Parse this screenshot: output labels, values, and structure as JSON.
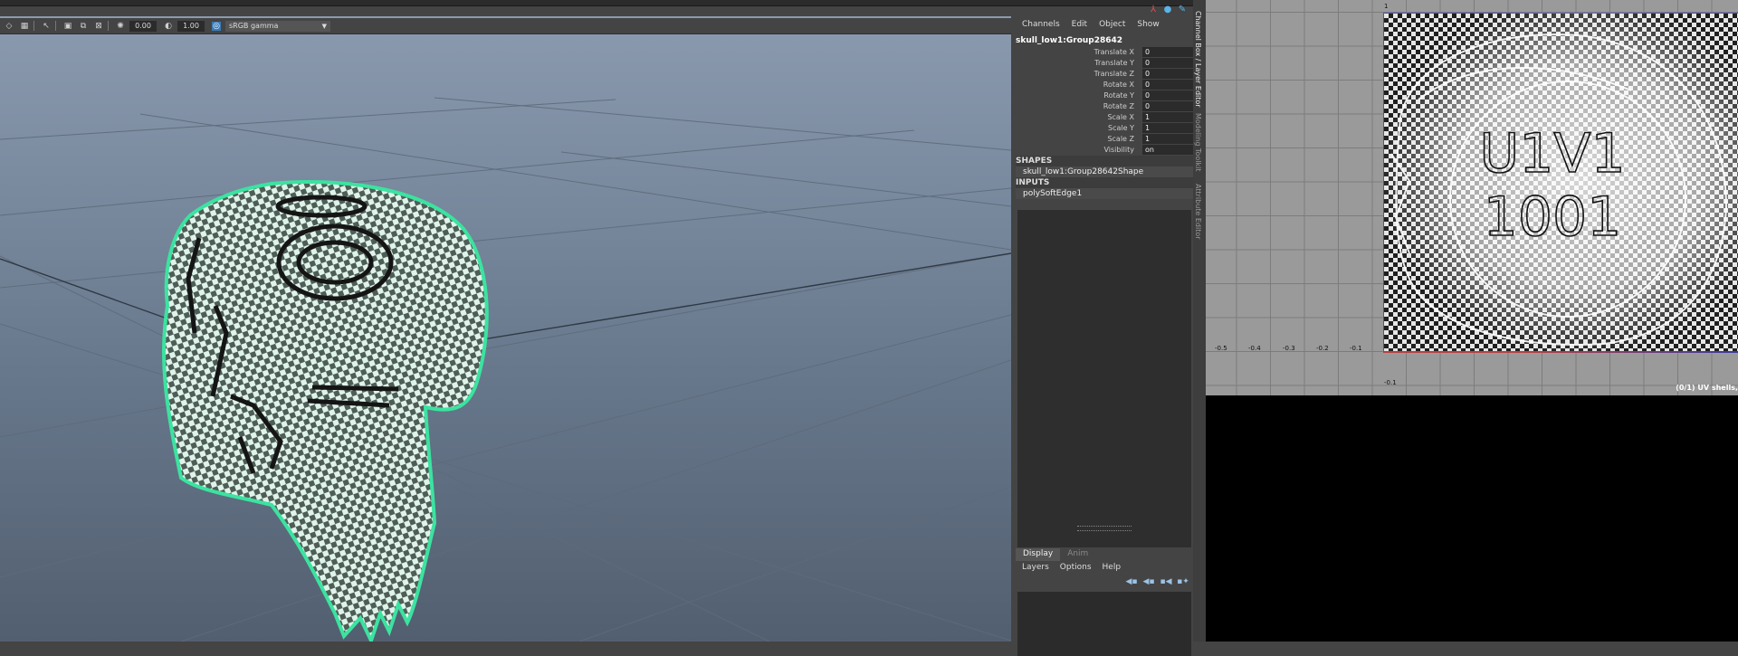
{
  "toolbar": {
    "exposure_value": "0.00",
    "gamma_value": "1.00",
    "color_space": "sRGB gamma"
  },
  "channel_box": {
    "menu": [
      "Channels",
      "Edit",
      "Object",
      "Show"
    ],
    "object_name": "skull_low1:Group28642",
    "attributes": [
      {
        "label": "Translate X",
        "value": "0"
      },
      {
        "label": "Translate Y",
        "value": "0"
      },
      {
        "label": "Translate Z",
        "value": "0"
      },
      {
        "label": "Rotate X",
        "value": "0"
      },
      {
        "label": "Rotate Y",
        "value": "0"
      },
      {
        "label": "Rotate Z",
        "value": "0"
      },
      {
        "label": "Scale X",
        "value": "1"
      },
      {
        "label": "Scale Y",
        "value": "1"
      },
      {
        "label": "Scale Z",
        "value": "1"
      },
      {
        "label": "Visibility",
        "value": "on"
      }
    ],
    "shapes_title": "SHAPES",
    "shape_item": "skull_low1:Group28642Shape",
    "inputs_title": "INPUTS",
    "input_item": "polySoftEdge1"
  },
  "layer_editor": {
    "tabs": [
      "Display",
      "Anim"
    ],
    "active_tab": "Display",
    "menu": [
      "Layers",
      "Options",
      "Help"
    ]
  },
  "side_tabs": [
    "Channel Box / Layer Editor",
    "Modeling Toolkit",
    "Attribute Editor"
  ],
  "uv_editor": {
    "texture_text_line1": "U1V1",
    "texture_text_line2": "1001",
    "axis_labels_u": [
      "-0.5",
      "-0.4",
      "-0.3",
      "-0.2",
      "-0.1"
    ],
    "axis_label_top": "1",
    "axis_label_v": "-0.1",
    "status": "(0/1) UV shells,"
  },
  "viewport": {
    "mesh_color": "#3be3a0",
    "mesh_name": "skull mesh with checker texture"
  }
}
